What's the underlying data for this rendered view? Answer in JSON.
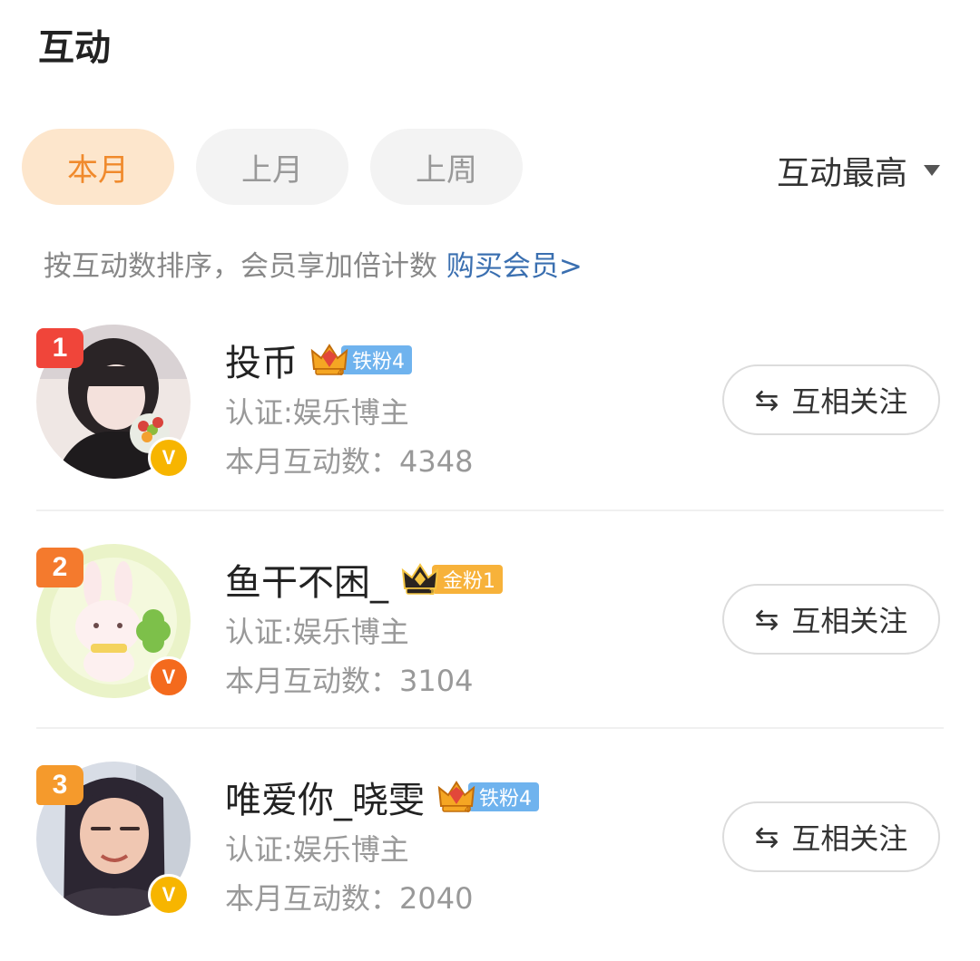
{
  "header": {
    "title": "互动"
  },
  "tabs": [
    {
      "label": "本月",
      "active": true
    },
    {
      "label": "上月",
      "active": false
    },
    {
      "label": "上周",
      "active": false
    }
  ],
  "sort": {
    "label": "互动最高",
    "icon": "dropdown-triangle-icon"
  },
  "hint": {
    "text": "按互动数排序，会员享加倍计数 ",
    "link": "购买会员>"
  },
  "users": [
    {
      "rank": "1",
      "rank_color": "#f0453a",
      "name": "投币",
      "fan_level": "铁粉4",
      "fan_color": "#6fb3ee",
      "fan_crown_level": "4",
      "verified_color": "#f7b500",
      "cert": "认证:娱乐博主",
      "count_label": "本月互动数：4348",
      "follow_label": "互相关注"
    },
    {
      "rank": "2",
      "rank_color": "#f47a2d",
      "name": "鱼干不困_",
      "fan_level": "金粉1",
      "fan_color": "#f7b23a",
      "fan_crown_level": "1",
      "verified_color": "#f46a1d",
      "cert": "认证:娱乐博主",
      "count_label": "本月互动数：3104",
      "follow_label": "互相关注"
    },
    {
      "rank": "3",
      "rank_color": "#f59a2c",
      "name": "唯爱你_晓雯",
      "fan_level": "铁粉4",
      "fan_color": "#6fb3ee",
      "fan_crown_level": "4",
      "verified_color": "#f7b500",
      "cert": "认证:娱乐博主",
      "count_label": "本月互动数：2040",
      "follow_label": "互相关注"
    }
  ]
}
